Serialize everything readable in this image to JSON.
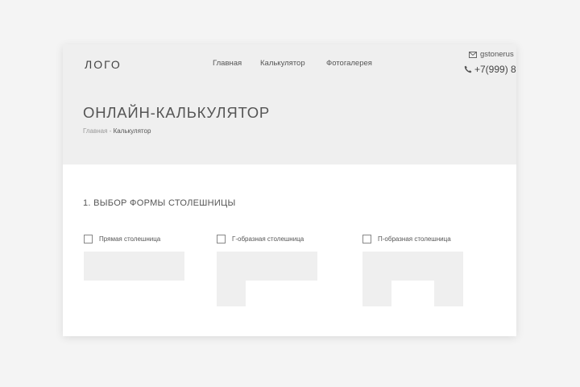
{
  "header": {
    "logo": "ЛОГО",
    "nav": [
      "Главная",
      "Калькулятор",
      "Фотогалерея"
    ],
    "email": "gstonerus",
    "phone": "+7(999) 8"
  },
  "hero": {
    "title": "ОНЛАЙН-КАЛЬКУЛЯТОР",
    "breadcrumb": {
      "home": "Главная",
      "separator": " - ",
      "current": "Калькулятор"
    }
  },
  "main": {
    "section_title": "1. ВЫБОР ФОРМЫ СТОЛЕШНИЦЫ",
    "options": [
      {
        "label": "Прямая столешница",
        "checked": false,
        "shape": "straight"
      },
      {
        "label": "Г-образная столешница",
        "checked": false,
        "shape": "l-shaped"
      },
      {
        "label": "П-образная столешница",
        "checked": false,
        "shape": "u-shaped"
      }
    ]
  },
  "icons": {
    "email": "envelope-icon",
    "phone": "phone-icon"
  },
  "colors": {
    "page_background": "#f4f4f4",
    "hero_background": "#efefef",
    "shape_fill": "#efefef",
    "text": "#444444"
  }
}
